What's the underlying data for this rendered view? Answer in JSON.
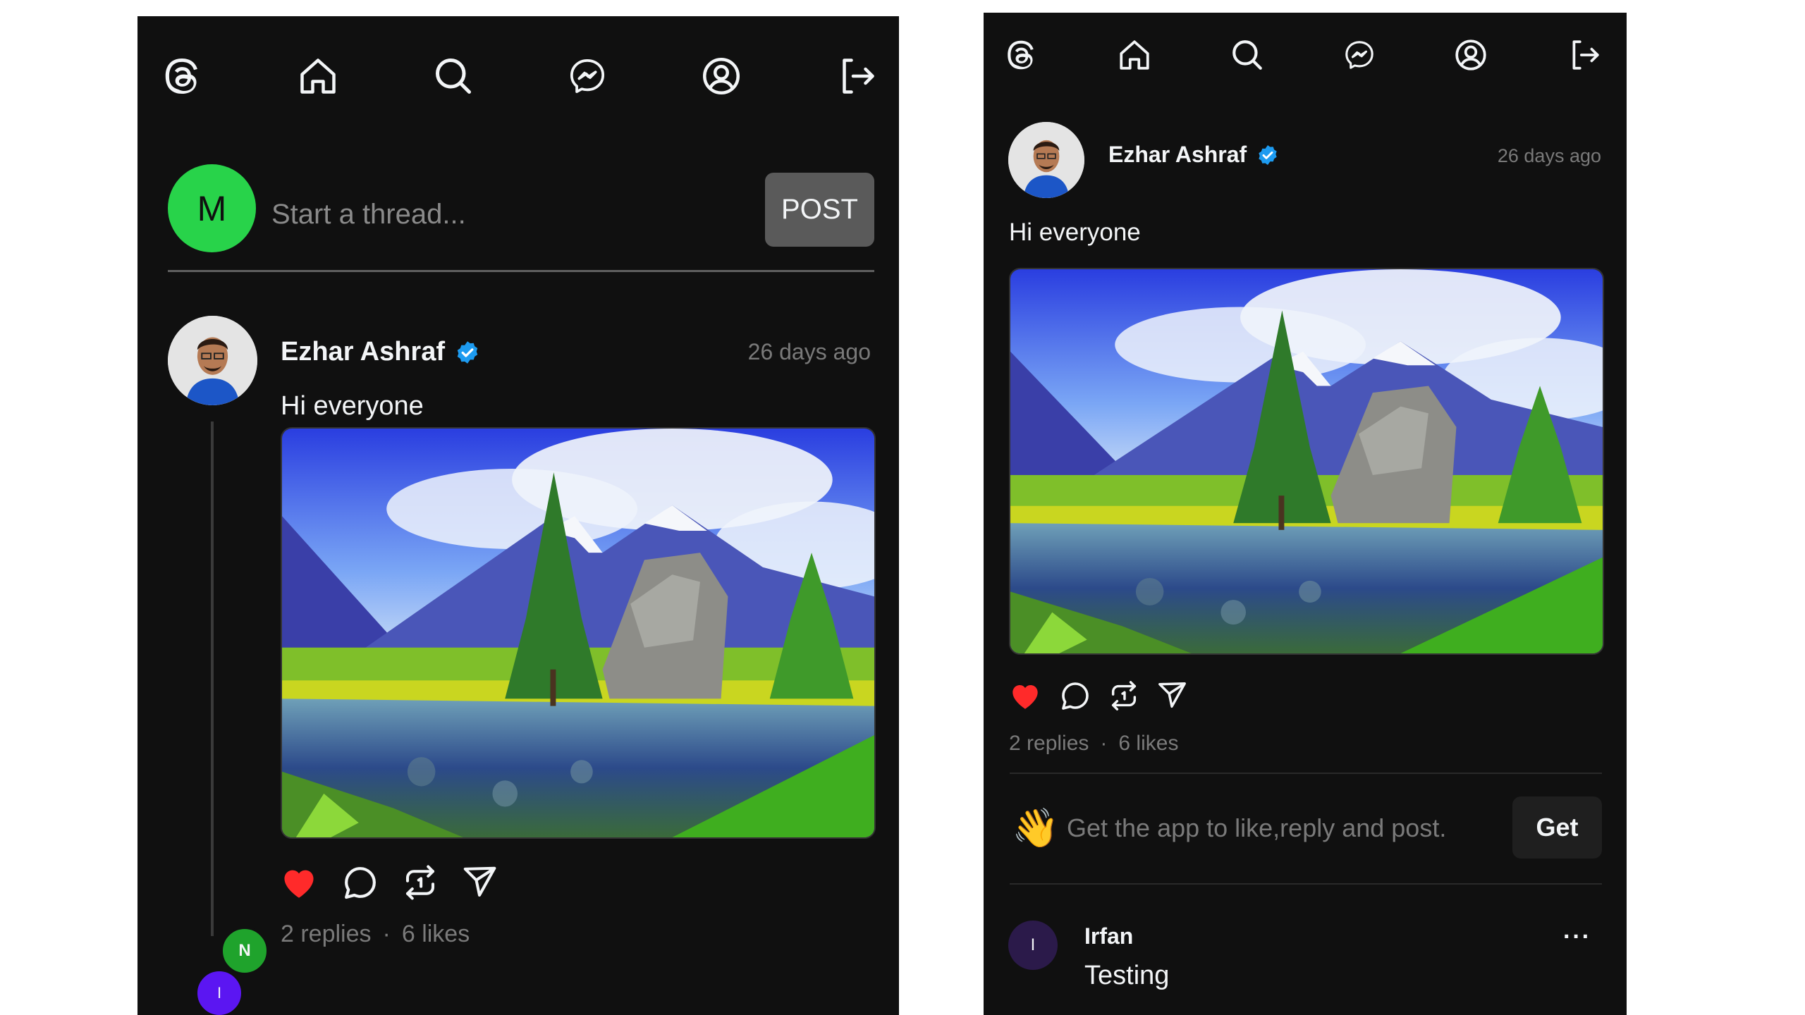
{
  "composer": {
    "avatar_initial": "M",
    "placeholder": "Start a thread...",
    "post_label": "POST"
  },
  "post": {
    "author": "Ezhar Ashraf",
    "time": "26 days ago",
    "text": "Hi everyone",
    "replies": "2 replies",
    "likes": "6 likes",
    "separator": "·"
  },
  "thread": {
    "reply_initial_1": "N",
    "reply_initial_2": "I"
  },
  "get_app": {
    "emoji": "👋",
    "text": "Get the app to like,reply and post.",
    "button": "Get"
  },
  "reply": {
    "avatar_initial": "I",
    "name": "Irfan",
    "text": "Testing",
    "more": "···"
  },
  "colors": {
    "panel_bg": "#101010",
    "like_red": "#ff2a2a",
    "verified_blue": "#1d9bf0",
    "composer_avatar": "#28d34a",
    "post_btn": "#5a5a5a"
  },
  "icons": [
    "threads-logo-icon",
    "home-icon",
    "search-icon",
    "messenger-icon",
    "profile-icon",
    "logout-icon",
    "heart-icon",
    "comment-icon",
    "repost-icon",
    "share-icon",
    "verified-icon"
  ]
}
